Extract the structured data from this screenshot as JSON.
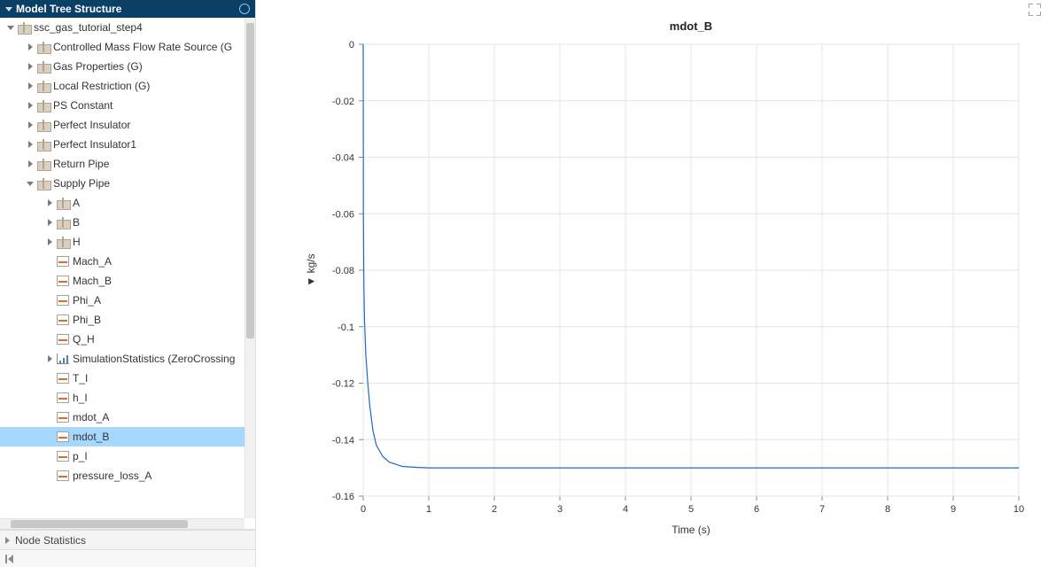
{
  "panel": {
    "tree_header": "Model Tree Structure",
    "stats_header": "Node Statistics"
  },
  "tree": {
    "root": "ssc_gas_tutorial_step4",
    "items": [
      {
        "label": "Controlled Mass Flow Rate Source (G",
        "indent": 1,
        "expand": "closed",
        "icon": "pkg"
      },
      {
        "label": "Gas Properties (G)",
        "indent": 1,
        "expand": "closed",
        "icon": "pkg"
      },
      {
        "label": "Local Restriction (G)",
        "indent": 1,
        "expand": "closed",
        "icon": "pkg"
      },
      {
        "label": "PS Constant",
        "indent": 1,
        "expand": "closed",
        "icon": "pkg"
      },
      {
        "label": "Perfect Insulator",
        "indent": 1,
        "expand": "closed",
        "icon": "pkg"
      },
      {
        "label": "Perfect Insulator1",
        "indent": 1,
        "expand": "closed",
        "icon": "pkg"
      },
      {
        "label": "Return Pipe",
        "indent": 1,
        "expand": "closed",
        "icon": "pkg"
      },
      {
        "label": "Supply Pipe",
        "indent": 1,
        "expand": "open",
        "icon": "pkg"
      },
      {
        "label": "A",
        "indent": 2,
        "expand": "closed",
        "icon": "pkg"
      },
      {
        "label": "B",
        "indent": 2,
        "expand": "closed",
        "icon": "pkg"
      },
      {
        "label": "H",
        "indent": 2,
        "expand": "closed",
        "icon": "pkg"
      },
      {
        "label": "Mach_A",
        "indent": 2,
        "expand": "none",
        "icon": "sig"
      },
      {
        "label": "Mach_B",
        "indent": 2,
        "expand": "none",
        "icon": "sig"
      },
      {
        "label": "Phi_A",
        "indent": 2,
        "expand": "none",
        "icon": "sig"
      },
      {
        "label": "Phi_B",
        "indent": 2,
        "expand": "none",
        "icon": "sig"
      },
      {
        "label": "Q_H",
        "indent": 2,
        "expand": "none",
        "icon": "sig"
      },
      {
        "label": "SimulationStatistics (ZeroCrossing",
        "indent": 2,
        "expand": "closed",
        "icon": "stats"
      },
      {
        "label": "T_I",
        "indent": 2,
        "expand": "none",
        "icon": "sig"
      },
      {
        "label": "h_I",
        "indent": 2,
        "expand": "none",
        "icon": "sig"
      },
      {
        "label": "mdot_A",
        "indent": 2,
        "expand": "none",
        "icon": "sig"
      },
      {
        "label": "mdot_B",
        "indent": 2,
        "expand": "none",
        "icon": "sig",
        "selected": true
      },
      {
        "label": "p_I",
        "indent": 2,
        "expand": "none",
        "icon": "sig"
      },
      {
        "label": "pressure_loss_A",
        "indent": 2,
        "expand": "none",
        "icon": "sig"
      }
    ]
  },
  "chart_data": {
    "type": "line",
    "title": "mdot_B",
    "xlabel": "Time (s)",
    "ylabel": "kg/s",
    "xlim": [
      0,
      10
    ],
    "ylim": [
      -0.16,
      0
    ],
    "xticks": [
      0,
      1,
      2,
      3,
      4,
      5,
      6,
      7,
      8,
      9,
      10
    ],
    "yticks": [
      0,
      -0.02,
      -0.04,
      -0.06,
      -0.08,
      -0.1,
      -0.12,
      -0.14,
      -0.16
    ],
    "series": [
      {
        "name": "mdot_B",
        "color": "#2068c8",
        "x": [
          0,
          0.003,
          0.01,
          0.02,
          0.04,
          0.07,
          0.1,
          0.15,
          0.2,
          0.3,
          0.4,
          0.6,
          0.8,
          1.0,
          1.5,
          2.0,
          3.0,
          4.0,
          6.0,
          8.0,
          10.0
        ],
        "y": [
          0.0,
          -0.06,
          -0.085,
          -0.098,
          -0.11,
          -0.12,
          -0.128,
          -0.137,
          -0.142,
          -0.146,
          -0.148,
          -0.1495,
          -0.1498,
          -0.15,
          -0.15,
          -0.15,
          -0.15,
          -0.15,
          -0.15,
          -0.15,
          -0.15
        ]
      }
    ]
  }
}
